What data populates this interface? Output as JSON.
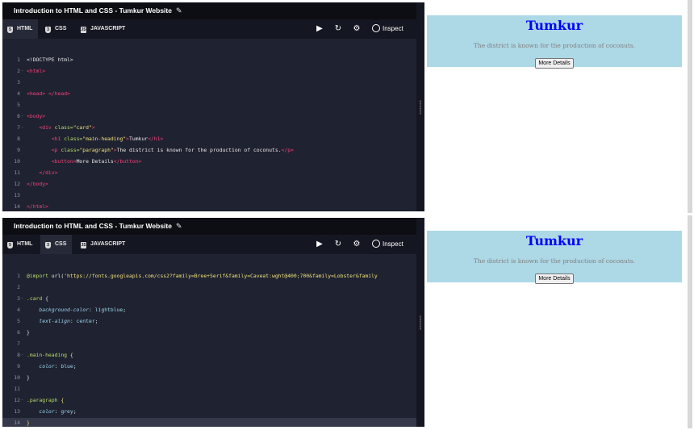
{
  "panels": [
    {
      "title": "Introduction to HTML and CSS - Tumkur Website",
      "active_tab": "HTML",
      "code_lines": [
        {
          "n": "1",
          "fold": "",
          "html": "&lt;!DOCTYPE html&gt;"
        },
        {
          "n": "2",
          "fold": "-",
          "html": "<span class=\"tg\">&lt;html&gt;</span>"
        },
        {
          "n": "3",
          "fold": "",
          "html": ""
        },
        {
          "n": "4",
          "fold": "",
          "html": "<span class=\"tg\">&lt;head&gt;</span> <span class=\"tg\">&lt;/head&gt;</span>"
        },
        {
          "n": "5",
          "fold": "",
          "html": ""
        },
        {
          "n": "6",
          "fold": "-",
          "html": "<span class=\"tg\">&lt;body&gt;</span>"
        },
        {
          "n": "7",
          "fold": "-",
          "html": "    <span class=\"tg\">&lt;div</span> <span class=\"at\">class=</span><span class=\"st\">\"card\"</span><span class=\"tg\">&gt;</span>"
        },
        {
          "n": "8",
          "fold": "",
          "html": "        <span class=\"tg\">&lt;h1</span> <span class=\"at\">class=</span><span class=\"st\">\"main-heading\"</span><span class=\"tg\">&gt;</span>Tumkur<span class=\"tg\">&lt;/h1&gt;</span>"
        },
        {
          "n": "9",
          "fold": "",
          "html": "        <span class=\"tg\">&lt;p</span> <span class=\"at\">class=</span><span class=\"st\">\"paragraph\"</span><span class=\"tg\">&gt;</span>The district is known for the production of coconuts.<span class=\"tg\">&lt;/p&gt;</span>"
        },
        {
          "n": "10",
          "fold": "",
          "html": "        <span class=\"tg\">&lt;button&gt;</span>More Details<span class=\"tg\">&lt;/button&gt;</span>"
        },
        {
          "n": "11",
          "fold": "",
          "html": "    <span class=\"tg\">&lt;/div&gt;</span>"
        },
        {
          "n": "12",
          "fold": "",
          "html": "<span class=\"tg\">&lt;/body&gt;</span>"
        },
        {
          "n": "13",
          "fold": "",
          "html": ""
        },
        {
          "n": "14",
          "fold": "",
          "html": "<span class=\"tg\">&lt;/html&gt;</span>"
        }
      ]
    },
    {
      "title": "Introduction to HTML and CSS - Tumkur Website",
      "active_tab": "CSS",
      "code_lines": [
        {
          "n": "1",
          "fold": "",
          "html": "<span class=\"at\">@import</span> url(<span class=\"st\">'https://fonts.googleapis.com/css2?family=Bree+Serif&amp;family=Caveat:wght@400;700&amp;family=Lobster&amp;family</span>"
        },
        {
          "n": "2",
          "fold": "",
          "html": ""
        },
        {
          "n": "3",
          "fold": "-",
          "html": "<span class=\"at\">.card</span> {"
        },
        {
          "n": "4",
          "fold": "",
          "html": "    <span class=\"pr\">background-color</span>: <span class=\"vl\">lightblue</span>;"
        },
        {
          "n": "5",
          "fold": "",
          "html": "    <span class=\"pr\">text-align</span>: <span class=\"vl\">center</span>;"
        },
        {
          "n": "6",
          "fold": "",
          "html": "}"
        },
        {
          "n": "7",
          "fold": "",
          "html": ""
        },
        {
          "n": "8",
          "fold": "-",
          "html": "<span class=\"at\">.main-heading</span> {"
        },
        {
          "n": "9",
          "fold": "",
          "html": "    <span class=\"pr\">color</span>: <span class=\"vl\">blue</span>;"
        },
        {
          "n": "10",
          "fold": "",
          "html": "}"
        },
        {
          "n": "11",
          "fold": "",
          "html": ""
        },
        {
          "n": "12",
          "fold": "-",
          "html": "<span class=\"at\">.paragraph</span> <span class=\"st\">{</span>"
        },
        {
          "n": "13",
          "fold": "",
          "html": "    <span class=\"pr\">color</span>: <span class=\"vl\">grey</span>;"
        },
        {
          "n": "14",
          "fold": "",
          "html": "<span class=\"st\">}</span>"
        }
      ]
    }
  ],
  "tabs": [
    "HTML",
    "CSS",
    "JAVASCRIPT"
  ],
  "tab_icons": [
    "html5-icon",
    "css3-icon",
    "javascript-icon"
  ],
  "toolbar": {
    "run_icon": "play-icon",
    "reset_icon": "refresh-icon",
    "settings_icon": "gear-icon",
    "inspect_label": "Inspect"
  },
  "preview": {
    "heading": "Tumkur",
    "paragraph": "The district is known for the production of coconuts.",
    "button_label": "More Details"
  },
  "colors": {
    "editor_bg": "#1f2230",
    "title_bg": "#0d0e13",
    "card_bg": "#add8e6",
    "heading": "#0000ff",
    "paragraph": "#808080"
  }
}
